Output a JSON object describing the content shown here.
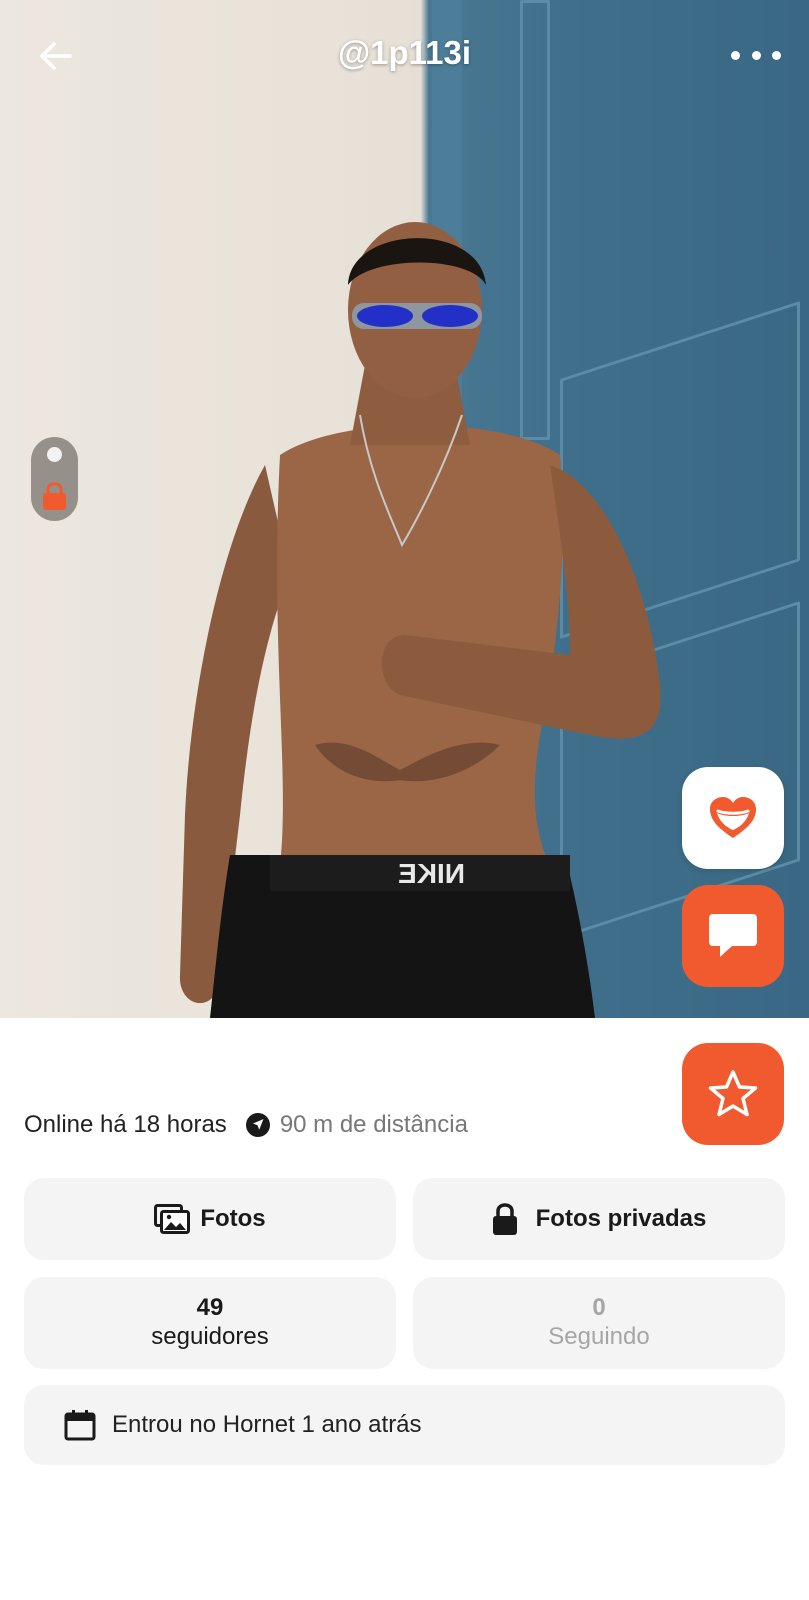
{
  "header": {
    "handle": "@1p113i",
    "back_icon": "arrow-left-icon",
    "more_icon": "more-horizontal-icon"
  },
  "photo": {
    "private_toggle_icon": "lock-icon"
  },
  "actions": {
    "heart_icon": "heart-icon",
    "chat_icon": "chat-bubble-icon",
    "favorite_icon": "star-icon"
  },
  "status": {
    "online": "Online há 18 horas",
    "distance": "90 m de distância"
  },
  "buttons": {
    "photos": "Fotos",
    "private_photos": "Fotos privadas"
  },
  "stats": {
    "followers_count": "49",
    "followers_label": "seguidores",
    "following_count": "0",
    "following_label": "Seguindo"
  },
  "joined": {
    "text": "Entrou no Hornet 1 ano atrás"
  },
  "colors": {
    "accent": "#f05a2e",
    "card_bg": "#f4f4f4",
    "muted_text": "#a6a6a6"
  }
}
